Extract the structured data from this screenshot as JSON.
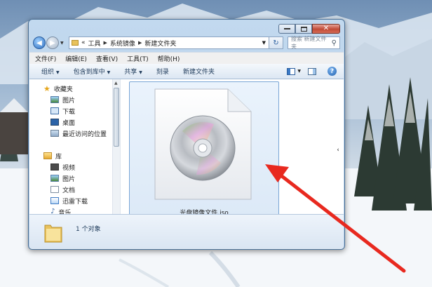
{
  "window": {
    "minimize_icon": "minimize-icon",
    "maximize_icon": "maximize-icon",
    "close_icon": "close-icon"
  },
  "address": {
    "prefix": "«",
    "crumbs": [
      "工具",
      "系统镜像",
      "新建文件夹"
    ],
    "search_placeholder": "搜索 新建文件夹"
  },
  "menu": [
    "文件(F)",
    "编辑(E)",
    "查看(V)",
    "工具(T)",
    "帮助(H)"
  ],
  "toolbar": {
    "organize": "组织",
    "include_in_library": "包含到库中",
    "share": "共享",
    "burn": "刻录",
    "new_folder": "新建文件夹"
  },
  "sidebar": {
    "favorites": "收藏夹",
    "favorites_items": [
      "图片",
      "下载",
      "桌面",
      "最近访问的位置"
    ],
    "libraries": "库",
    "library_items": [
      "视频",
      "图片",
      "文档",
      "迅雷下载",
      "音乐"
    ]
  },
  "file": {
    "name": "光盘镜像文件.iso",
    "icon": "disc-image-icon"
  },
  "status": {
    "count": "1 个对象"
  },
  "colors": {
    "arrow": "#e8291f",
    "selection_border": "#7aa6d6"
  }
}
